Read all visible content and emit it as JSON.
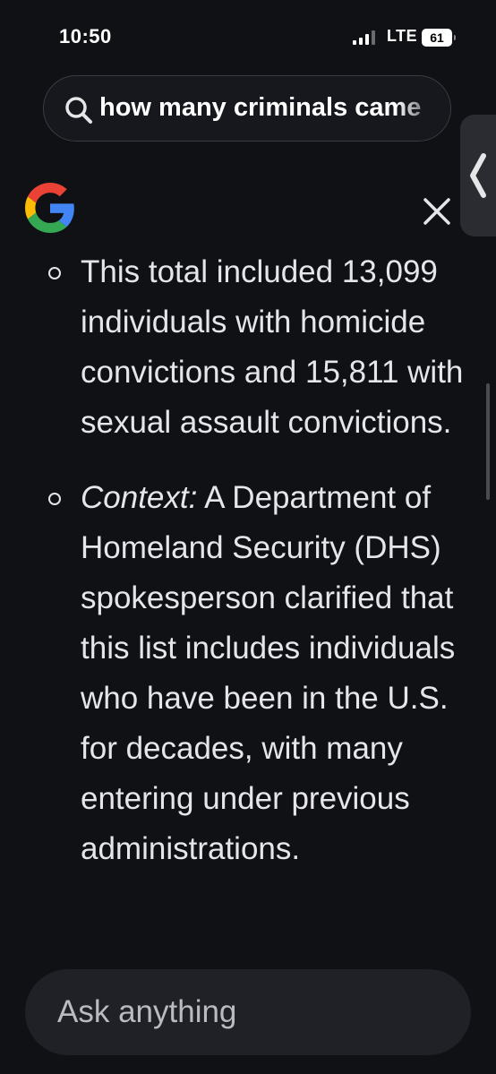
{
  "status_bar": {
    "time": "10:50",
    "network": "LTE",
    "battery": "61",
    "signal_bars": 3
  },
  "search": {
    "query": "how many criminals came"
  },
  "content": {
    "items": [
      {
        "label": "",
        "text": "This total included 13,099 individuals with homicide convictions and 15,811 with sexual assault convictions."
      },
      {
        "label": "Context:",
        "text": " A Department of Homeland Security (DHS) spokesperson clarified that this list includes individuals who have been in the U.S. for decades, with many entering under previous administrations."
      }
    ]
  },
  "ask": {
    "placeholder": "Ask anything"
  },
  "icons": {
    "search": "search-icon",
    "close": "close-icon",
    "logo": "google-logo",
    "side_tab": "chevron-left-icon"
  },
  "colors": {
    "background": "#0f1115",
    "text": "#e6e6e9",
    "google_blue": "#4285F4",
    "google_red": "#EA4335",
    "google_yellow": "#FBBC05",
    "google_green": "#34A853"
  }
}
